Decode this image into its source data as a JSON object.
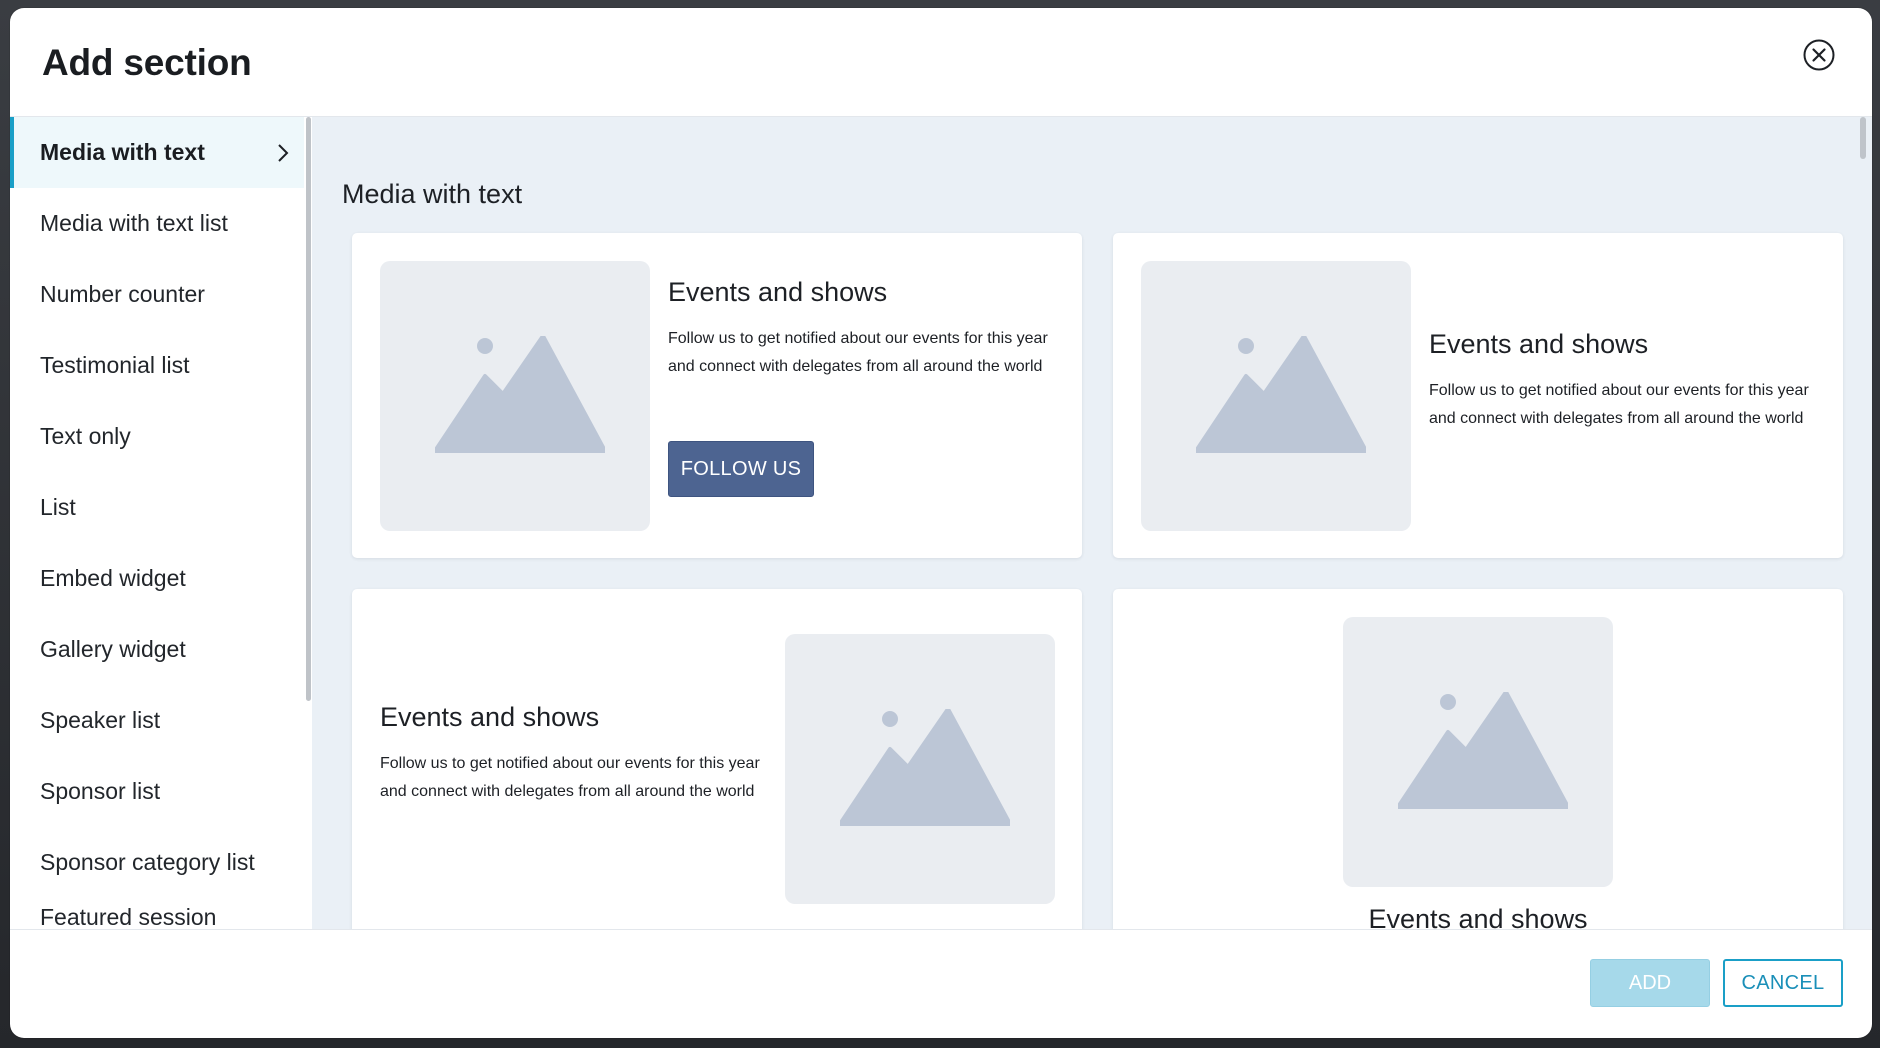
{
  "dialog": {
    "title": "Add section"
  },
  "sidebar": {
    "items": [
      {
        "label": "Media with text",
        "active": true
      },
      {
        "label": "Media with text list"
      },
      {
        "label": "Number counter"
      },
      {
        "label": "Testimonial list"
      },
      {
        "label": "Text only"
      },
      {
        "label": "List"
      },
      {
        "label": "Embed widget"
      },
      {
        "label": "Gallery widget"
      },
      {
        "label": "Speaker list"
      },
      {
        "label": "Sponsor list"
      },
      {
        "label": "Sponsor category list"
      },
      {
        "label": "Featured session"
      }
    ]
  },
  "main": {
    "section_title": "Media with text",
    "cards": [
      {
        "heading": "Events and shows",
        "body": "Follow us to get notified about our events for this year and connect with delegates from all around the world",
        "button_label": "FOLLOW US"
      },
      {
        "heading": "Events and shows",
        "body": "Follow us to get notified about our events for this year and connect with delegates from all around the world"
      },
      {
        "heading": "Events and shows",
        "body": "Follow us to get notified about our events for this year and connect with delegates from all around the world"
      },
      {
        "heading": "Events and shows"
      }
    ]
  },
  "footer": {
    "add_label": "ADD",
    "cancel_label": "CANCEL"
  },
  "colors": {
    "accent": "#1a9fc7",
    "active_bg": "#eef8fb",
    "content_bg": "#eaf0f6",
    "follow_button": "#4d6491",
    "add_disabled": "#a6d9ea",
    "placeholder": "#bcc6d6"
  }
}
